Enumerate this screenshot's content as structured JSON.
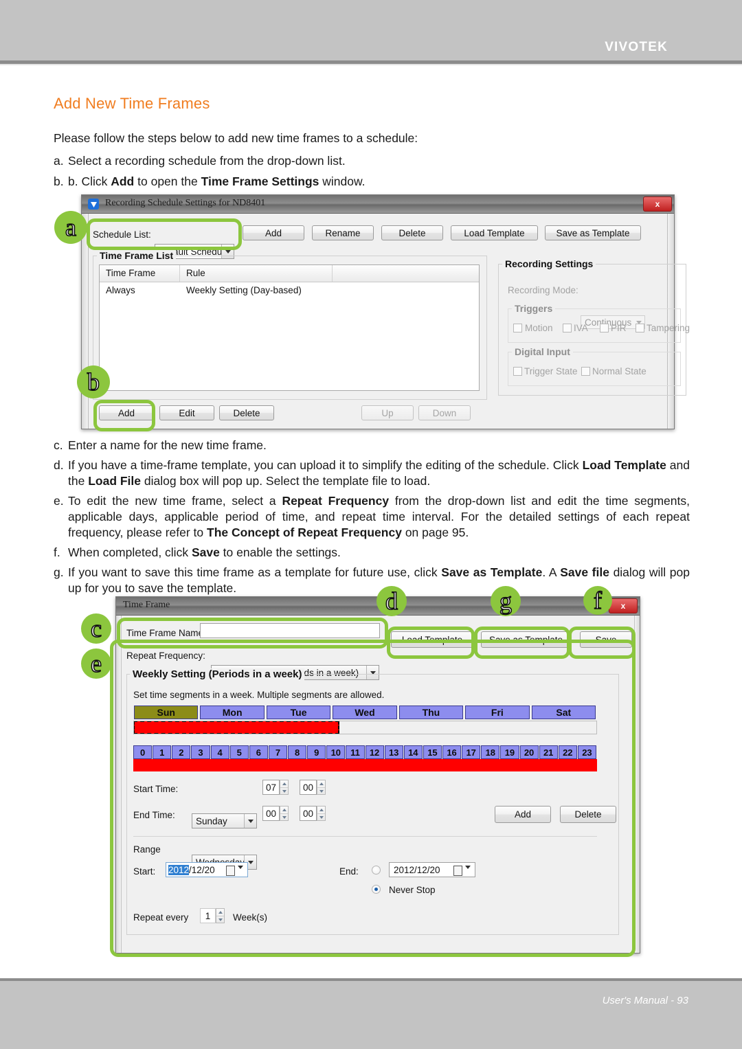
{
  "header": {
    "brand": "VIVOTEK"
  },
  "footer": {
    "text": "User's Manual - 93"
  },
  "page": {
    "title": "Add New Time Frames",
    "intro": "Please follow the steps below to add new time frames to a schedule:",
    "steps": {
      "a": {
        "marker": "a.",
        "text": "Select a recording schedule from the drop-down list."
      },
      "b": {
        "marker": "b.",
        "text": "Click Add to open the Time Frame Settings window."
      },
      "c": {
        "marker": "c.",
        "text": "Enter a name for the new time frame."
      },
      "d": {
        "marker": "d.",
        "text": "If you have a time-frame template, you can upload it to simplify the editing of the schedule. Click Load Template and the Load File dialog box will pop up. Select the template file to load."
      },
      "e": {
        "marker": "e.",
        "text": "To edit the new time frame, select a Repeat Frequency from the drop-down list and edit the time segments, applicable days, applicable period of time, and repeat time interval. For the detailed settings of each repeat frequency, please refer to The Concept of Repeat Frequency on page 95."
      },
      "f": {
        "marker": "f.",
        "text": "When completed, click Save to enable the settings."
      },
      "g": {
        "marker": "g.",
        "text": "If you want to save this time frame as a template for future use, click Save as Template. A Save file dialog will pop up for you to save the template."
      }
    }
  },
  "callouts": {
    "a": "a",
    "b": "b",
    "c": "c",
    "d": "d",
    "e": "e",
    "f": "f",
    "g": "g"
  },
  "dialog1": {
    "title": "Recording Schedule Settings for ND8401",
    "close": "x",
    "schedule_list_label": "Schedule List:",
    "schedule_list_value": "Default Schedule",
    "buttons": {
      "add": "Add",
      "rename": "Rename",
      "delete": "Delete",
      "load_template": "Load Template",
      "save_as_template": "Save as Template"
    },
    "time_frame_list_label": "Time Frame List",
    "table": {
      "columns": [
        "Time Frame",
        "Rule",
        ""
      ],
      "rows": [
        [
          "Always",
          "Weekly Setting (Day-based)",
          ""
        ]
      ]
    },
    "bottom_buttons": {
      "add": "Add",
      "edit": "Edit",
      "delete": "Delete",
      "up": "Up",
      "down": "Down"
    },
    "recording_settings": {
      "group_label": "Recording Settings",
      "mode_label": "Recording Mode:",
      "mode_value": "Continuous",
      "triggers_label": "Triggers",
      "triggers": [
        "Motion",
        "IVA",
        "PIR",
        "Tampering"
      ],
      "digital_input_label": "Digital Input",
      "digital_inputs": [
        "Trigger State",
        "Normal State"
      ]
    }
  },
  "dialog2": {
    "title": "Time Frame",
    "close": "x",
    "name_label": "Time Frame Name:",
    "name_value": "",
    "buttons": {
      "load_template": "Load Template",
      "save_as_template": "Save as Template",
      "save": "Save"
    },
    "repeat_frequency_label": "Repeat Frequency:",
    "repeat_frequency_value": "Weekly Setting (Periods in a week)",
    "group_label": "Weekly Setting (Periods in a week)",
    "hint": "Set time segments in a week. Multiple segments are allowed.",
    "days": [
      "Sun",
      "Mon",
      "Tue",
      "Wed",
      "Thu",
      "Fri",
      "Sat"
    ],
    "selected_day": "Sun",
    "hours": [
      "0",
      "1",
      "2",
      "3",
      "4",
      "5",
      "6",
      "7",
      "8",
      "9",
      "10",
      "11",
      "12",
      "13",
      "14",
      "15",
      "16",
      "17",
      "18",
      "19",
      "20",
      "21",
      "22",
      "23"
    ],
    "start_time": {
      "label": "Start Time:",
      "day": "Sunday",
      "hour": "07",
      "minute": "00"
    },
    "end_time": {
      "label": "End Time:",
      "day": "Wednesday",
      "hour": "00",
      "minute": "00"
    },
    "segment_buttons": {
      "add": "Add",
      "delete": "Delete"
    },
    "range": {
      "label": "Range",
      "start_label": "Start:",
      "start_year": "2012",
      "start_rest": "/12/20",
      "end_label": "End:",
      "end_value": "2012/12/20",
      "never_stop": "Never Stop",
      "never_stop_selected": true,
      "repeat_every_label": "Repeat every",
      "repeat_every_value": "1",
      "repeat_unit": "Week(s)"
    }
  },
  "colors": {
    "accent_heading": "#f07d20",
    "callout_green": "#8cc63e",
    "band_gray": "#c3c3c3",
    "day_blue": "#8d8dee",
    "day_selected": "#8c8c18",
    "segment_red": "#ff0000"
  }
}
